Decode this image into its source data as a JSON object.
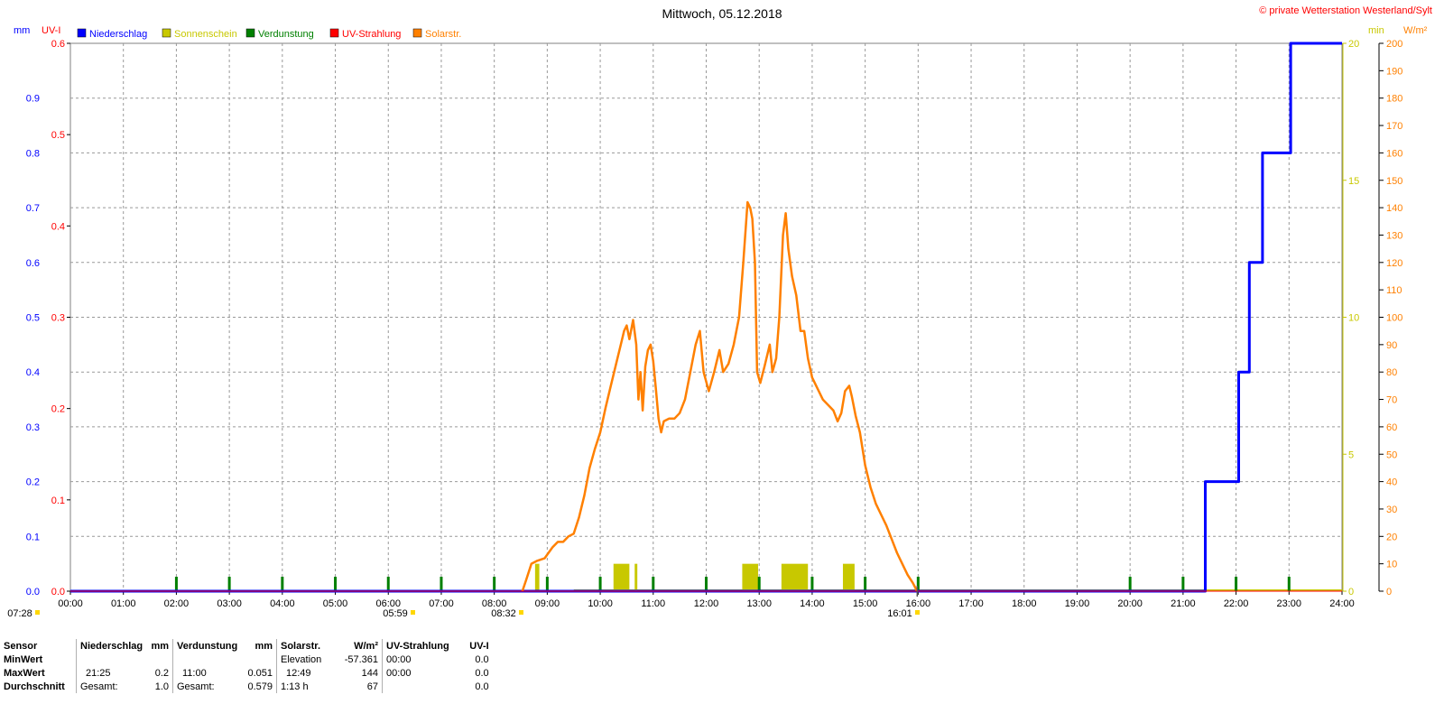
{
  "chart_data": {
    "type": "line",
    "title": "Mittwoch, 05.12.2018",
    "copyright": "© private Wetterstation Westerland/Sylt",
    "left_axis_labels": [
      "mm",
      "UV-I"
    ],
    "right_axis_labels": [
      "min",
      "W/m²"
    ],
    "legend": [
      {
        "name": "Niederschlag",
        "color": "#0000ff"
      },
      {
        "name": "Sonnenschein",
        "color": "#c8c800"
      },
      {
        "name": "Verdunstung",
        "color": "#008000"
      },
      {
        "name": "UV-Strahlung",
        "color": "#ff0000"
      },
      {
        "name": "Solarstr.",
        "color": "#ff8000"
      }
    ],
    "x_ticks": [
      "00:00",
      "01:00",
      "02:00",
      "03:00",
      "04:00",
      "05:00",
      "06:00",
      "07:00",
      "08:00",
      "09:00",
      "10:00",
      "11:00",
      "12:00",
      "13:00",
      "14:00",
      "15:00",
      "16:00",
      "17:00",
      "18:00",
      "19:00",
      "20:00",
      "21:00",
      "22:00",
      "23:00",
      "24:00"
    ],
    "axes": {
      "mm": {
        "min": 0,
        "max": 1.0,
        "ticks": [
          "0.0",
          "0.1",
          "0.2",
          "0.3",
          "0.4",
          "0.5",
          "0.6",
          "0.7",
          "0.8",
          "0.9"
        ]
      },
      "uv": {
        "min": 0,
        "max": 0.6,
        "ticks": [
          "0.0",
          "0.1",
          "0.2",
          "0.3",
          "0.4",
          "0.5",
          "0.6"
        ]
      },
      "min": {
        "min": 0,
        "max": 20,
        "ticks": [
          "0",
          "5",
          "10",
          "15",
          "20"
        ]
      },
      "wm2": {
        "min": 0,
        "max": 200,
        "ticks": [
          "0",
          "10",
          "20",
          "30",
          "40",
          "50",
          "60",
          "70",
          "80",
          "90",
          "100",
          "110",
          "120",
          "130",
          "140",
          "150",
          "160",
          "170",
          "180",
          "190",
          "200"
        ]
      }
    },
    "markers": [
      {
        "label": "07:28",
        "hour": 0
      },
      {
        "label": "05:59",
        "hour": 6
      },
      {
        "label": "08:32",
        "hour": 8.533
      },
      {
        "label": "16:01",
        "hour": 15.983
      }
    ],
    "series": [
      {
        "name": "Niederschlag",
        "axis": "mm",
        "step": true,
        "points": [
          [
            0,
            0
          ],
          [
            21.42,
            0
          ],
          [
            21.42,
            0.2
          ],
          [
            22.05,
            0.2
          ],
          [
            22.05,
            0.4
          ],
          [
            22.25,
            0.4
          ],
          [
            22.25,
            0.6
          ],
          [
            22.5,
            0.6
          ],
          [
            22.5,
            0.8
          ],
          [
            23.03,
            0.8
          ],
          [
            23.03,
            1.0
          ],
          [
            24,
            1.0
          ]
        ]
      },
      {
        "name": "Solarstr.",
        "axis": "wm2",
        "points": [
          [
            8.53,
            0
          ],
          [
            8.6,
            4
          ],
          [
            8.7,
            10
          ],
          [
            8.8,
            11
          ],
          [
            8.95,
            12
          ],
          [
            9.1,
            16
          ],
          [
            9.2,
            18
          ],
          [
            9.3,
            18
          ],
          [
            9.4,
            20
          ],
          [
            9.5,
            21
          ],
          [
            9.6,
            27
          ],
          [
            9.7,
            35
          ],
          [
            9.8,
            45
          ],
          [
            9.9,
            52
          ],
          [
            10.0,
            58
          ],
          [
            10.1,
            67
          ],
          [
            10.2,
            75
          ],
          [
            10.3,
            83
          ],
          [
            10.4,
            91
          ],
          [
            10.45,
            95
          ],
          [
            10.5,
            97
          ],
          [
            10.55,
            92
          ],
          [
            10.62,
            99
          ],
          [
            10.68,
            90
          ],
          [
            10.72,
            70
          ],
          [
            10.76,
            80
          ],
          [
            10.8,
            66
          ],
          [
            10.85,
            82
          ],
          [
            10.9,
            88
          ],
          [
            10.95,
            90
          ],
          [
            11.0,
            84
          ],
          [
            11.05,
            74
          ],
          [
            11.1,
            63
          ],
          [
            11.15,
            58
          ],
          [
            11.2,
            62
          ],
          [
            11.3,
            63
          ],
          [
            11.4,
            63
          ],
          [
            11.5,
            65
          ],
          [
            11.6,
            70
          ],
          [
            11.7,
            80
          ],
          [
            11.8,
            90
          ],
          [
            11.88,
            95
          ],
          [
            11.95,
            80
          ],
          [
            12.05,
            73
          ],
          [
            12.15,
            80
          ],
          [
            12.25,
            88
          ],
          [
            12.32,
            80
          ],
          [
            12.42,
            83
          ],
          [
            12.52,
            90
          ],
          [
            12.62,
            100
          ],
          [
            12.7,
            120
          ],
          [
            12.78,
            142
          ],
          [
            12.83,
            140
          ],
          [
            12.87,
            136
          ],
          [
            12.92,
            120
          ],
          [
            12.96,
            80
          ],
          [
            13.02,
            76
          ],
          [
            13.1,
            82
          ],
          [
            13.2,
            90
          ],
          [
            13.25,
            80
          ],
          [
            13.32,
            85
          ],
          [
            13.38,
            100
          ],
          [
            13.45,
            130
          ],
          [
            13.5,
            138
          ],
          [
            13.55,
            125
          ],
          [
            13.62,
            115
          ],
          [
            13.7,
            108
          ],
          [
            13.78,
            95
          ],
          [
            13.85,
            95
          ],
          [
            13.92,
            85
          ],
          [
            14.0,
            78
          ],
          [
            14.1,
            74
          ],
          [
            14.2,
            70
          ],
          [
            14.3,
            68
          ],
          [
            14.4,
            66
          ],
          [
            14.48,
            62
          ],
          [
            14.55,
            65
          ],
          [
            14.62,
            73
          ],
          [
            14.7,
            75
          ],
          [
            14.75,
            71
          ],
          [
            14.82,
            64
          ],
          [
            14.9,
            58
          ],
          [
            15.0,
            46
          ],
          [
            15.1,
            38
          ],
          [
            15.2,
            32
          ],
          [
            15.3,
            28
          ],
          [
            15.4,
            24
          ],
          [
            15.5,
            19
          ],
          [
            15.6,
            14
          ],
          [
            15.7,
            10
          ],
          [
            15.8,
            6
          ],
          [
            15.9,
            3
          ],
          [
            15.98,
            0
          ]
        ]
      },
      {
        "name": "Sonnenschein",
        "axis": "min",
        "bars": [
          [
            8.77,
            8.85,
            1.0
          ],
          [
            10.25,
            10.55,
            1.0
          ],
          [
            10.65,
            10.7,
            1.0
          ],
          [
            12.68,
            12.98,
            1.0
          ],
          [
            13.42,
            13.92,
            1.0
          ],
          [
            14.58,
            14.8,
            1.0
          ]
        ]
      },
      {
        "name": "Verdunstung",
        "axis": "mm",
        "spikes": [
          2,
          3,
          4,
          5,
          6,
          7,
          8,
          9,
          10,
          11,
          12,
          13,
          14,
          15,
          16,
          20,
          21,
          22,
          23
        ]
      }
    ],
    "stats": {
      "headers": [
        "Sensor",
        "Niederschlag",
        "mm",
        "Verdunstung",
        "mm",
        "Solarstr.",
        "W/m²",
        "UV-Strahlung",
        "UV-I"
      ],
      "rows": [
        {
          "label": "MinWert",
          "n_time": "",
          "n_val": "",
          "v_time": "",
          "v_val": "",
          "s_label": "Elevation",
          "s_val": "-57.361",
          "u_time": "00:00",
          "u_val": "0.0"
        },
        {
          "label": "MaxWert",
          "n_time": "21:25",
          "n_val": "0.2",
          "v_time": "11:00",
          "v_val": "0.051",
          "s_label": "12:49",
          "s_val": "144",
          "u_time": "00:00",
          "u_val": "0.0"
        },
        {
          "label": "Durchschnitt",
          "n_time": "Gesamt:",
          "n_val": "1.0",
          "v_time": "Gesamt:",
          "v_val": "0.579",
          "s_label": "1:13 h",
          "s_val": "67",
          "u_time": "",
          "u_val": "0.0"
        }
      ]
    }
  }
}
